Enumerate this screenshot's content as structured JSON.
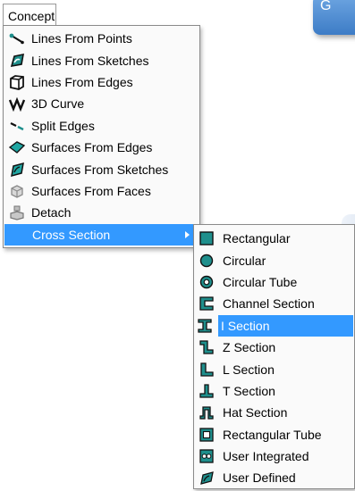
{
  "menubar": {
    "title": "Concept"
  },
  "main_menu": {
    "items": [
      {
        "label": "Lines From Points",
        "icon": "lines-from-points-icon"
      },
      {
        "label": "Lines From Sketches",
        "icon": "lines-from-sketches-icon"
      },
      {
        "label": "Lines From Edges",
        "icon": "lines-from-edges-icon"
      },
      {
        "label": "3D Curve",
        "icon": "3d-curve-icon"
      },
      {
        "label": "Split Edges",
        "icon": "split-edges-icon"
      },
      {
        "label": "Surfaces From Edges",
        "icon": "surfaces-from-edges-icon"
      },
      {
        "label": "Surfaces From Sketches",
        "icon": "surfaces-from-sketches-icon"
      },
      {
        "label": "Surfaces From Faces",
        "icon": "surfaces-from-faces-icon"
      },
      {
        "label": "Detach",
        "icon": "detach-icon"
      },
      {
        "label": "Cross Section",
        "icon": "submenu-arrow-icon"
      }
    ]
  },
  "cross_section_menu": {
    "items": [
      {
        "label": "Rectangular",
        "icon": "rectangular-section-icon"
      },
      {
        "label": "Circular",
        "icon": "circular-section-icon"
      },
      {
        "label": "Circular Tube",
        "icon": "circular-tube-icon"
      },
      {
        "label": "Channel Section",
        "icon": "channel-section-icon"
      },
      {
        "label": "I Section",
        "icon": "i-section-icon"
      },
      {
        "label": "Z Section",
        "icon": "z-section-icon"
      },
      {
        "label": "L Section",
        "icon": "l-section-icon"
      },
      {
        "label": "T Section",
        "icon": "t-section-icon"
      },
      {
        "label": "Hat Section",
        "icon": "hat-section-icon"
      },
      {
        "label": "Rectangular Tube",
        "icon": "rectangular-tube-icon"
      },
      {
        "label": "User Integrated",
        "icon": "user-integrated-icon"
      },
      {
        "label": "User Defined",
        "icon": "user-defined-icon"
      }
    ]
  },
  "callout": {
    "text": "G"
  },
  "colors": {
    "highlight": "#3399ff",
    "icon_teal": "#1f8f8c",
    "icon_dark": "#2b2b2b"
  }
}
